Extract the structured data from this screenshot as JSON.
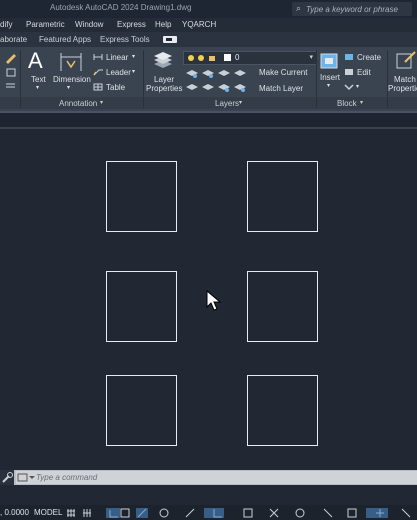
{
  "app": {
    "title": "Autodesk AutoCAD 2024    Drawing1.dwg",
    "search_placeholder": "Type a keyword or phrase"
  },
  "menu": [
    "dify",
    "Parametric",
    "Window",
    "Express",
    "Help",
    "YQARCH"
  ],
  "ribbon_tabs": [
    "aborate",
    "Featured Apps",
    "Express Tools"
  ],
  "ribbon": {
    "annotation": {
      "text_label": "Text",
      "dimension_label": "Dimension",
      "linear_label": "Linear",
      "leader_label": "Leader",
      "table_label": "Table",
      "panel_title": "Annotation"
    },
    "layers": {
      "properties_label": "Layer Properties",
      "properties_line1": "Layer",
      "properties_line2": "Properties",
      "current_layer": "0",
      "make_current_label": "Make Current",
      "match_layer_label": "Match Layer",
      "panel_title": "Layers"
    },
    "block": {
      "insert_label": "Insert",
      "create_label": "Create",
      "edit_label": "Edit",
      "panel_title": "Block"
    },
    "match_properties": {
      "line1": "Match",
      "line2": "Properties"
    }
  },
  "command_line": {
    "placeholder": "Type a command"
  },
  "status_bar": {
    "coords": ", 0.0000",
    "model_label": "MODEL"
  },
  "colors": {
    "canvas": "#212833",
    "ribbon": "#3a4350",
    "rect_stroke": "#e8ecf0"
  }
}
